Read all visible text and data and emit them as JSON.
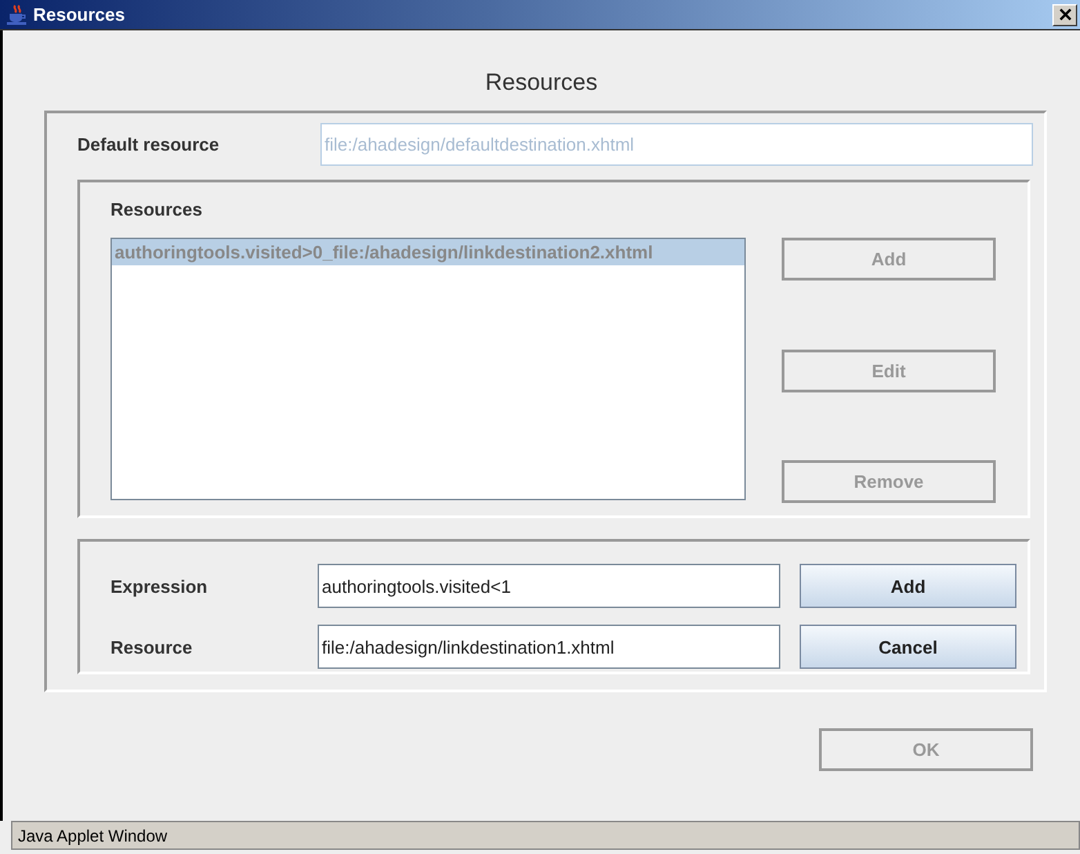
{
  "window": {
    "title": "Resources"
  },
  "heading": "Resources",
  "default_resource": {
    "label": "Default resource",
    "value": "file:/ahadesign/defaultdestination.xhtml",
    "disabled": true
  },
  "resources": {
    "label": "Resources",
    "items": [
      {
        "text": "authoringtools.visited>0_file:/ahadesign/linkdestination2.xhtml",
        "selected": true
      }
    ],
    "buttons": [
      {
        "label": "Add",
        "disabled": true
      },
      {
        "label": "Edit",
        "disabled": true
      },
      {
        "label": "Remove",
        "disabled": true
      }
    ]
  },
  "editor": {
    "rows": [
      {
        "label": "Expression",
        "value": "authoringtools.visited<1",
        "button": {
          "label": "Add",
          "disabled": false
        }
      },
      {
        "label": "Resource",
        "value": "file:/ahadesign/linkdestination1.xhtml",
        "button": {
          "label": "Cancel",
          "disabled": false
        }
      }
    ]
  },
  "ok_button": {
    "label": "OK",
    "disabled": true
  },
  "status_bar": "Java Applet Window"
}
